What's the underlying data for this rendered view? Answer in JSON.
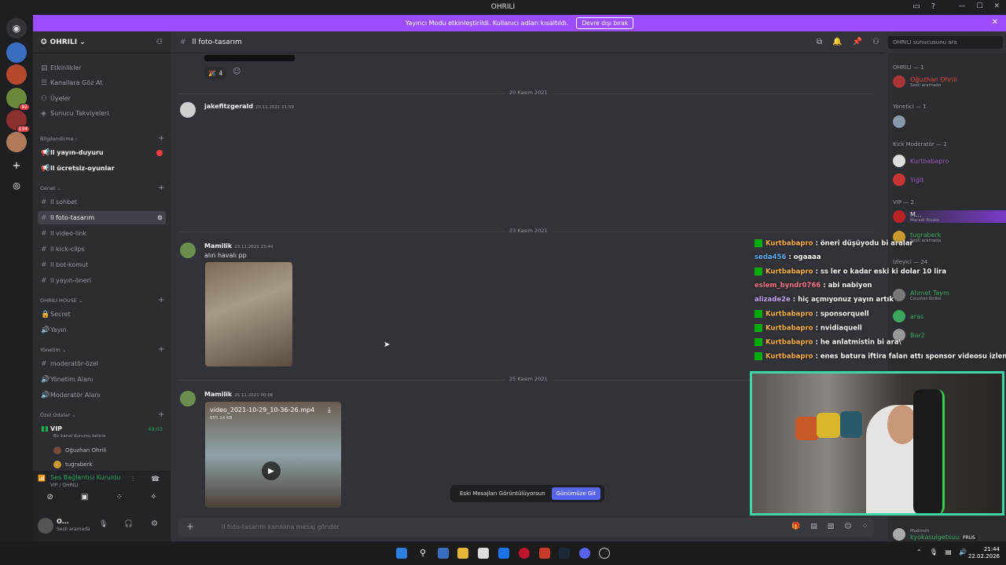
{
  "window": {
    "title": "OHRILI"
  },
  "banner": {
    "text": "Yayıncı Modu etkinleştirildi. Kullanıcı adları kısaltıldı.",
    "button": "Devre dışı bırak"
  },
  "sidebar": {
    "guild_name": "OHRILI",
    "top_items": [
      "Etkinlikler",
      "Kanallara Göz At",
      "Üyeler",
      "Sunucu Takviyeleri"
    ],
    "categories": [
      {
        "name": "Bilgilendirme",
        "channels": [
          "ll yayın-duyuru",
          "ll ücretsiz-oyunlar"
        ]
      },
      {
        "name": "Genel",
        "channels": [
          "ll sohbet",
          "ll foto-tasarım",
          "ll video-link",
          "ll kick-clips",
          "ll bot-komut",
          "ll yayın-öneri"
        ]
      },
      {
        "name": "OHRILI HOUSE",
        "channels": [
          "Secret",
          "Yayın"
        ]
      },
      {
        "name": "Yönetim",
        "channels": [
          "moderatör-özel",
          "Yönetim Alanı",
          "Moderatör Alanı"
        ]
      },
      {
        "name": "Özel Odalar",
        "channels": [
          "VIP"
        ]
      }
    ],
    "vip_status": "Bir kanal durumu belirle",
    "vip_timer": "49:03",
    "vip_users": [
      "Oğuzhan Ohrili",
      "tugraberk"
    ]
  },
  "voice": {
    "status": "Ses Bağlantısı Kuruldu",
    "channel": "VIP / OHRILI"
  },
  "user": {
    "name": "O...",
    "status": "Sesli aramada"
  },
  "chat": {
    "channel": "ll foto-tasarım",
    "reaction_count": "4",
    "dates": [
      "20 Kasım 2021",
      "23 Kasım 2021",
      "25 Kasım 2021"
    ],
    "messages": [
      {
        "user": "jakefitzgerald",
        "time": "20.11.2021 21:59",
        "text": ""
      },
      {
        "user": "Mamilik",
        "time": "23.11.2021 23:44",
        "text": "alın havalı pp"
      },
      {
        "user": "Mamilik",
        "time": "25.11.2021 00:06",
        "text": ""
      }
    ],
    "video": {
      "filename": "video_2021-10-29_10-36-26.mp4",
      "size": "655.14 KB"
    },
    "toast": {
      "text": "Eski Mesajları Görüntülüyorsun",
      "button": "Günümüze Git"
    },
    "composer_placeholder": "ll foto-tasarım kanalına mesaj gönder",
    "search_placeholder": "OHRILI sunucusunu ara"
  },
  "members": {
    "groups": [
      {
        "label": "OHRILI — 1",
        "members": [
          {
            "name": "Oğuzhan Ohrili",
            "status": "Sesli aramada",
            "color": "#e74c3c"
          }
        ]
      },
      {
        "label": "Yönetici — 1",
        "members": [
          {
            "name": "",
            "status": "",
            "color": "#ffffff"
          }
        ]
      },
      {
        "label": "Kick Moderatör — 2",
        "members": [
          {
            "name": "Kurtbabapro",
            "status": "",
            "color": "#9b59b6"
          },
          {
            "name": "Yiğit",
            "status": "",
            "color": "#9b59b6"
          }
        ]
      },
      {
        "label": "VIP — 2",
        "members": [
          {
            "name": "M...",
            "status": "Marvel Rivals",
            "color": "#ffffff"
          },
          {
            "name": "tugraberk",
            "status": "Sesli aramada",
            "color": "#3ba55d"
          }
        ]
      },
      {
        "label": "İzleyici — 24",
        "members": [
          {
            "name": "Ahmet Taym",
            "status": "Counter-Strike",
            "color": "#3ba55d"
          },
          {
            "name": "aras",
            "status": "",
            "color": "#3ba55d"
          },
          {
            "name": "Bar2",
            "status": "",
            "color": "#3ba55d"
          }
        ]
      }
    ],
    "bottom_member": "kyokasuigetsuu",
    "bottom_tag": "PRUS",
    "bottom_status": "Modrinth"
  },
  "twitch_chat": [
    {
      "user": "Kurtbabapro",
      "text": "öneri düşüyodu bi aralar",
      "mod": true,
      "color": "#ffb34d"
    },
    {
      "user": "seda456",
      "text": "ogaaaa",
      "mod": false,
      "color": "#5ab0ff"
    },
    {
      "user": "Kurtbabapro",
      "text": "ss ler o kadar eski ki dolar 10 lira",
      "mod": true,
      "color": "#ffb34d"
    },
    {
      "user": "eslem_byndr0766",
      "text": "abi nabiyon",
      "mod": false,
      "color": "#ff7a8a"
    },
    {
      "user": "alizade2e",
      "text": "hiç açmıyonuz yayın artık",
      "mod": false,
      "color": "#c9a6ff"
    },
    {
      "user": "Kurtbabapro",
      "text": "sponsorquell",
      "mod": true,
      "color": "#ffb34d"
    },
    {
      "user": "Kurtbabapro",
      "text": "nvidiaquell",
      "mod": true,
      "color": "#ffb34d"
    },
    {
      "user": "Kurtbabapro",
      "text": "he anlatmistin bi ara\\",
      "mod": true,
      "color": "#ffb34d"
    },
    {
      "user": "Kurtbabapro",
      "text": "enes batura iftira falan attı sponsor videosu izlensin diye",
      "mod": true,
      "color": "#ffb34d"
    }
  ],
  "taskbar": {
    "time": "21:44",
    "date": "22.02.2026"
  }
}
